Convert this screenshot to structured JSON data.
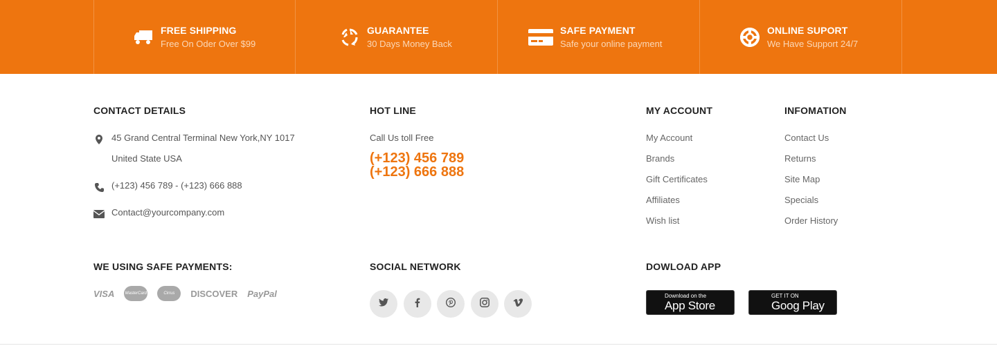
{
  "features": [
    {
      "icon": "truck-icon",
      "title": "FREE SHIPPING",
      "subtitle": "Free On Oder Over $99"
    },
    {
      "icon": "recycle-icon",
      "title": "GUARANTEE",
      "subtitle": "30 Days Money Back"
    },
    {
      "icon": "credit-card-icon",
      "title": "SAFE PAYMENT",
      "subtitle": "Safe your online payment"
    },
    {
      "icon": "lifebuoy-icon",
      "title": "ONLINE SUPORT",
      "subtitle": "We Have Support 24/7"
    }
  ],
  "contact": {
    "title": "CONTACT DETAILS",
    "address_line1": "45 Grand Central Terminal New York,NY 1017",
    "address_line2": "United State USA",
    "phone": "(+123) 456 789 - (+123) 666 888",
    "email": "Contact@yourcompany.com"
  },
  "hotline": {
    "title": "HOT LINE",
    "label": "Call Us toll Free",
    "numbers": [
      "(+123) 456 789",
      "(+123) 666 888"
    ]
  },
  "my_account": {
    "title": "MY ACCOUNT",
    "links": [
      "My Account",
      "Brands",
      "Gift Certificates",
      "Affiliates",
      "Wish list"
    ]
  },
  "information": {
    "title": "INFOMATION",
    "links": [
      "Contact Us",
      "Returns",
      "Site Map",
      "Specials",
      "Order History"
    ]
  },
  "payments": {
    "title": "WE USING SAFE PAYMENTS:",
    "methods": [
      "VISA",
      "MasterCard",
      "Cirrus",
      "DISCOVER",
      "PayPal"
    ]
  },
  "social": {
    "title": "SOCIAL NETWORK",
    "networks": [
      "twitter-icon",
      "facebook-icon",
      "pinterest-icon",
      "instagram-icon",
      "vimeo-icon"
    ]
  },
  "apps": {
    "title": "DOWLOAD APP",
    "app_store": {
      "small": "Download on the",
      "big": "App Store"
    },
    "google_play": {
      "small": "GET IT ON",
      "big": "Goog Play"
    }
  },
  "colors": {
    "accent": "#ee750f",
    "icon_grey": "#555555"
  }
}
